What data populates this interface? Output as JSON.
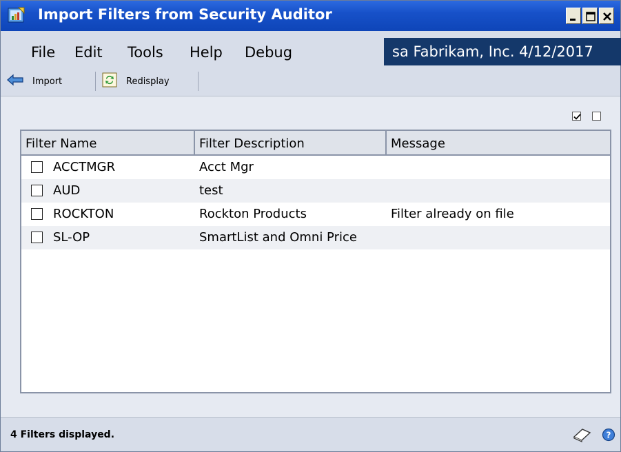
{
  "window": {
    "title": "Import Filters from Security Auditor",
    "controls": {
      "minimize": "_",
      "maximize": "□",
      "close": "X"
    }
  },
  "menu": {
    "items": [
      "File",
      "Edit",
      "Tools",
      "Help",
      "Debug"
    ],
    "company_info": "sa  Fabrikam, Inc.  4/12/2017"
  },
  "toolbar": {
    "import_label": "Import",
    "redisplay_label": "Redisplay"
  },
  "grid": {
    "columns": [
      "Filter Name",
      "Filter Description",
      "Message"
    ],
    "rows": [
      {
        "name": "ACCTMGR",
        "description": "Acct Mgr",
        "message": ""
      },
      {
        "name": "AUD",
        "description": "test",
        "message": ""
      },
      {
        "name": "ROCKTON",
        "description": "Rockton Products",
        "message": "Filter already on file"
      },
      {
        "name": "SL-OP",
        "description": "SmartList and Omni Price",
        "message": ""
      }
    ]
  },
  "status": {
    "text": "4 Filters displayed."
  },
  "icons": {
    "import": "arrow-left-icon",
    "redisplay": "refresh-icon",
    "note": "note-icon",
    "help": "help-icon"
  }
}
